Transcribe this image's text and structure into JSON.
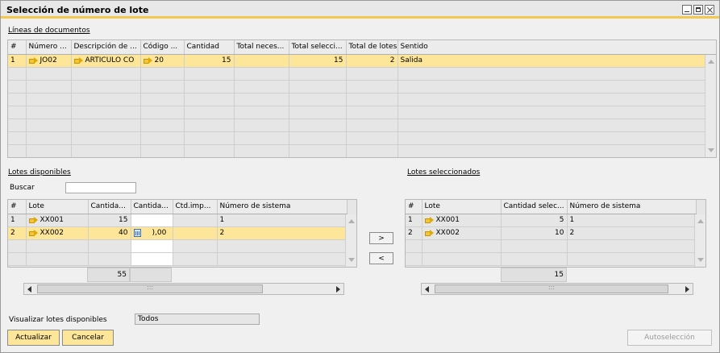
{
  "window": {
    "title": "Selección de número de lote"
  },
  "documents": {
    "section_label": "Líneas de documentos",
    "columns": [
      "#",
      "Número ...",
      "Descripción de ...",
      "Código ...",
      "Cantidad",
      "Total neces...",
      "Total selecci...",
      "Total de lotes",
      "Sentido"
    ],
    "rows": [
      {
        "num": "1",
        "numero": "JO02",
        "descripcion": "ARTICULO CO",
        "codigo": "20",
        "cantidad": "15",
        "total_neces": "",
        "total_selecc": "15",
        "total_lotes": "2",
        "sentido": "Salida"
      }
    ]
  },
  "available": {
    "section_label": "Lotes disponibles",
    "search_label": "Buscar",
    "search_value": "",
    "columns": [
      "#",
      "Lote",
      "Cantida...",
      "Cantida...",
      "Ctd.imp...",
      "Número de sistema"
    ],
    "rows": [
      {
        "num": "1",
        "lote": "XX001",
        "cantidad": "15",
        "cantidad2": "",
        "ctd_imp": "",
        "sistema": "1"
      },
      {
        "num": "2",
        "lote": "XX002",
        "cantidad": "40",
        "cantidad2": "),00",
        "ctd_imp": "",
        "sistema": "2"
      }
    ],
    "total": "55"
  },
  "selected": {
    "section_label": "Lotes seleccionados",
    "columns": [
      "#",
      "Lote",
      "Cantidad selec...",
      "Número de sistema"
    ],
    "rows": [
      {
        "num": "1",
        "lote": "XX001",
        "cantidad": "5",
        "sistema": "1"
      },
      {
        "num": "2",
        "lote": "XX002",
        "cantidad": "10",
        "sistema": "2"
      }
    ],
    "total": "15"
  },
  "transfer": {
    "add_label": ">",
    "remove_label": "<"
  },
  "view": {
    "label": "Visualizar lotes disponibles",
    "value": "Todos"
  },
  "buttons": {
    "update": "Actualizar",
    "cancel": "Cancelar",
    "auto": "Autoselección"
  },
  "colors": {
    "accent": "#f2c94c",
    "selected_row": "#fde59a"
  }
}
